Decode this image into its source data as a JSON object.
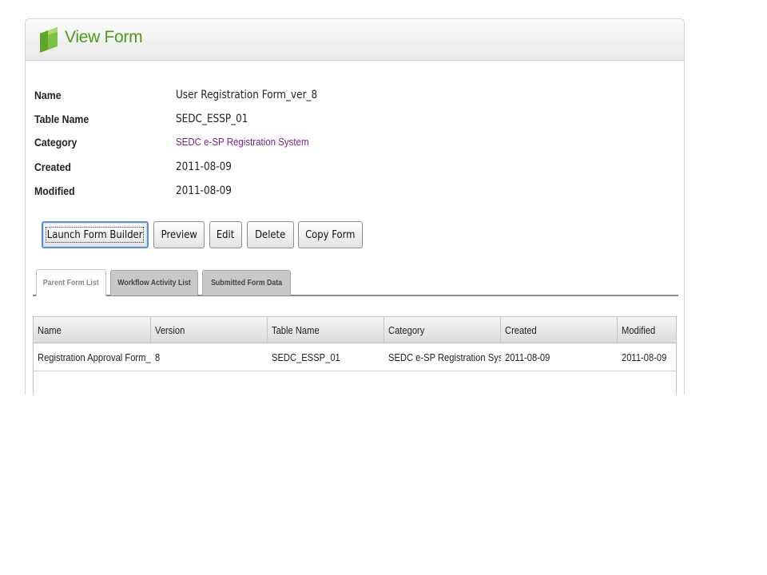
{
  "header": {
    "title": "View Form",
    "icon": "green-leaf-icon"
  },
  "details": [
    {
      "label": "Name",
      "value": "User Registration Form_ver_8"
    },
    {
      "label": "Table Name",
      "value": "SEDC_ESSP_01"
    },
    {
      "label": "Category",
      "value": "SEDC e-SP Registration System"
    },
    {
      "label": "Created",
      "value": "2011-08-09"
    },
    {
      "label": "Modified",
      "value": "2011-08-09"
    }
  ],
  "buttons": {
    "launch": "Launch Form Builder",
    "preview": "Preview",
    "edit": "Edit",
    "delete": "Delete",
    "copy": "Copy Form"
  },
  "tabs": [
    "Parent Form List",
    "Workflow Activity List",
    "Submitted Form Data"
  ],
  "table": {
    "columns": [
      "Name",
      "Version",
      "Table Name",
      "Category",
      "Created",
      "Modified"
    ],
    "rows": [
      [
        "Registration Approval Form_v",
        "8",
        "SEDC_ESSP_01",
        "SEDC e-SP Registration Syst",
        "2011-08-09",
        "2011-08-09"
      ]
    ]
  },
  "colors": {
    "title_green": "#4c9a1b",
    "link_purple": "#7a1f8c",
    "focus_blue": "#5b8fd6"
  }
}
